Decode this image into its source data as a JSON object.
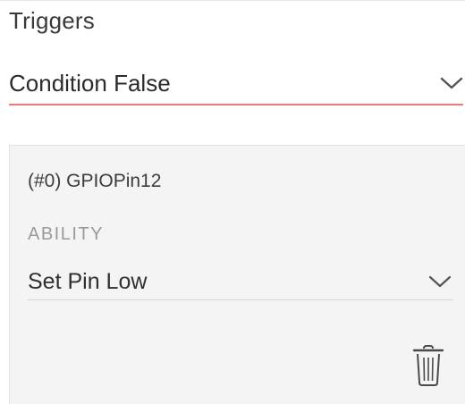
{
  "triggers": {
    "title": "Triggers",
    "selected_condition": "Condition False",
    "condition_icon": "chevron-down-icon",
    "accent_color": "#f07a7a"
  },
  "action": {
    "device_label": "(#0) GPIOPin12",
    "ability_label": "ABILITY",
    "selected_ability": "Set Pin Low",
    "ability_icon": "chevron-down-icon",
    "delete_icon": "trash-icon"
  }
}
